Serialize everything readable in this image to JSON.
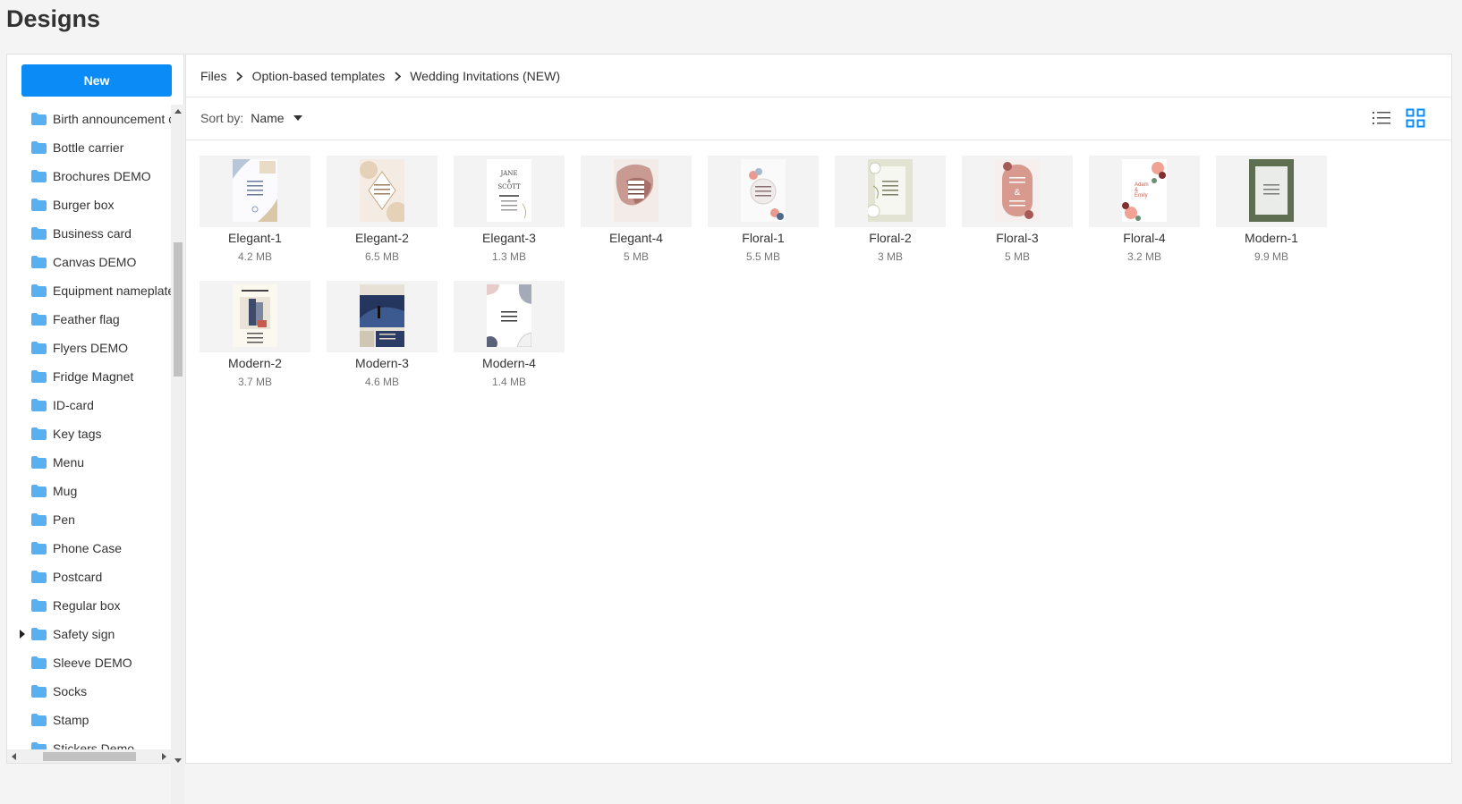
{
  "page_title": "Designs",
  "sidebar": {
    "new_label": "New",
    "items": [
      {
        "label": "Birth announcement cards",
        "expandable": false
      },
      {
        "label": "Bottle carrier",
        "expandable": false
      },
      {
        "label": "Brochures DEMO",
        "expandable": false
      },
      {
        "label": "Burger box",
        "expandable": false
      },
      {
        "label": "Business card",
        "expandable": false
      },
      {
        "label": "Canvas DEMO",
        "expandable": false
      },
      {
        "label": "Equipment nameplate",
        "expandable": false
      },
      {
        "label": "Feather flag",
        "expandable": false
      },
      {
        "label": "Flyers DEMO",
        "expandable": false
      },
      {
        "label": "Fridge Magnet",
        "expandable": false
      },
      {
        "label": "ID-card",
        "expandable": false
      },
      {
        "label": "Key tags",
        "expandable": false
      },
      {
        "label": "Menu",
        "expandable": false
      },
      {
        "label": "Mug",
        "expandable": false
      },
      {
        "label": "Pen",
        "expandable": false
      },
      {
        "label": "Phone Case",
        "expandable": false
      },
      {
        "label": "Postcard",
        "expandable": false
      },
      {
        "label": "Regular box",
        "expandable": false
      },
      {
        "label": "Safety sign",
        "expandable": true
      },
      {
        "label": "Sleeve DEMO",
        "expandable": false
      },
      {
        "label": "Socks",
        "expandable": false
      },
      {
        "label": "Stamp",
        "expandable": false
      },
      {
        "label": "Stickers Demo",
        "expandable": false
      }
    ]
  },
  "breadcrumb": [
    "Files",
    "Option-based templates",
    "Wedding Invitations (NEW)"
  ],
  "sort": {
    "label": "Sort by:",
    "value": "Name"
  },
  "colors": {
    "accent": "#0a8bf5",
    "folder": "#5aaff0"
  },
  "files": [
    {
      "name": "Elegant-1",
      "size": "4.2 MB",
      "style": "elegant1"
    },
    {
      "name": "Elegant-2",
      "size": "6.5 MB",
      "style": "elegant2"
    },
    {
      "name": "Elegant-3",
      "size": "1.3 MB",
      "style": "elegant3"
    },
    {
      "name": "Elegant-4",
      "size": "5 MB",
      "style": "elegant4"
    },
    {
      "name": "Floral-1",
      "size": "5.5 MB",
      "style": "floral1"
    },
    {
      "name": "Floral-2",
      "size": "3 MB",
      "style": "floral2"
    },
    {
      "name": "Floral-3",
      "size": "5 MB",
      "style": "floral3"
    },
    {
      "name": "Floral-4",
      "size": "3.2 MB",
      "style": "floral4"
    },
    {
      "name": "Modern-1",
      "size": "9.9 MB",
      "style": "modern1"
    },
    {
      "name": "Modern-2",
      "size": "3.7 MB",
      "style": "modern2"
    },
    {
      "name": "Modern-3",
      "size": "4.6 MB",
      "style": "modern3"
    },
    {
      "name": "Modern-4",
      "size": "1.4 MB",
      "style": "modern4"
    }
  ]
}
